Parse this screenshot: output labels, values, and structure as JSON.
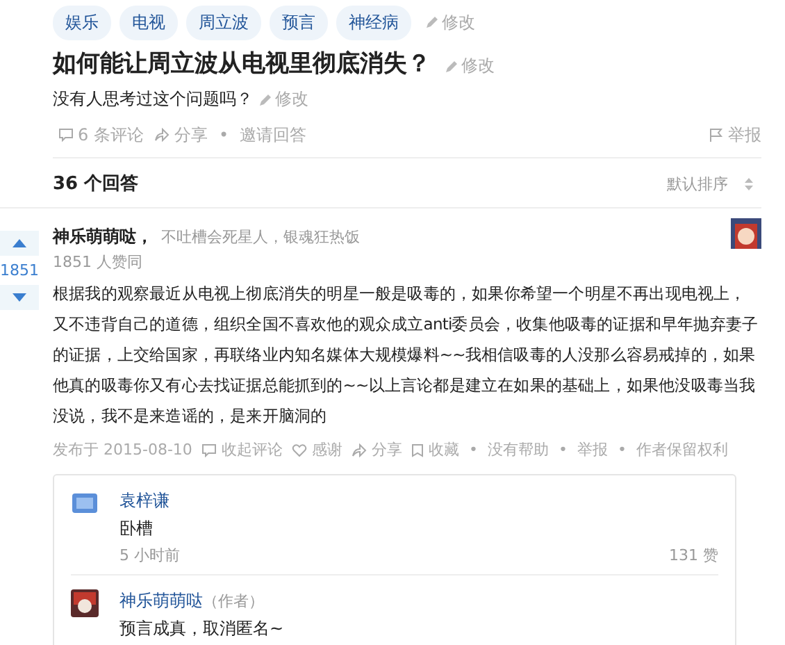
{
  "tags": [
    {
      "label": "娱乐"
    },
    {
      "label": "电视"
    },
    {
      "label": "周立波"
    },
    {
      "label": "预言"
    },
    {
      "label": "神经病"
    }
  ],
  "tags_edit": "修改",
  "question": {
    "title": "如何能让周立波从电视里彻底消失？",
    "title_edit": "修改",
    "detail": "没有人思考过这个问题吗？",
    "detail_edit": "修改"
  },
  "question_actions": {
    "comments": "6 条评论",
    "share": "分享",
    "sep": "•",
    "invite": "邀请回答",
    "report": "举报"
  },
  "answers_header": {
    "count": "36 个回答",
    "sort": "默认排序"
  },
  "answer": {
    "votes": "1851",
    "author": "神乐萌萌哒",
    "comma": "，",
    "bio": "不吐槽会死星人，银魂狂热饭",
    "likes": "1851 人赞同",
    "body": "根据我的观察最近从电视上彻底消失的明星一般是吸毒的，如果你希望一个明星不再出现电视上，又不违背自己的道德，组织全国不喜欢他的观众成立anti委员会，收集他吸毒的证据和早年抛弃妻子的证据，上交给国家，再联络业内知名媒体大规模爆料~~我相信吸毒的人没那么容易戒掉的，如果他真的吸毒你又有心去找证据总能抓到的~~以上言论都是建立在如果的基础上，如果他没吸毒当我没说，我不是来造谣的，是来开脑洞的",
    "meta": [
      {
        "kind": "text",
        "label": "发布于 2015-08-10"
      },
      {
        "kind": "comment",
        "label": "收起评论"
      },
      {
        "kind": "heart",
        "label": "感谢"
      },
      {
        "kind": "share",
        "label": "分享"
      },
      {
        "kind": "bookmark",
        "label": "收藏"
      },
      {
        "kind": "dot",
        "label": "•"
      },
      {
        "kind": "text",
        "label": "没有帮助"
      },
      {
        "kind": "dot",
        "label": "•"
      },
      {
        "kind": "text",
        "label": "举报"
      },
      {
        "kind": "dot",
        "label": "•"
      },
      {
        "kind": "text",
        "label": "作者保留权利"
      }
    ]
  },
  "comments": [
    {
      "author": "袁梓谦",
      "text": "卧槽",
      "time": "5 小时前",
      "likes": "131 赞"
    },
    {
      "author": "神乐萌萌哒",
      "role": "（作者）",
      "text": "预言成真，取消匿名~"
    }
  ]
}
